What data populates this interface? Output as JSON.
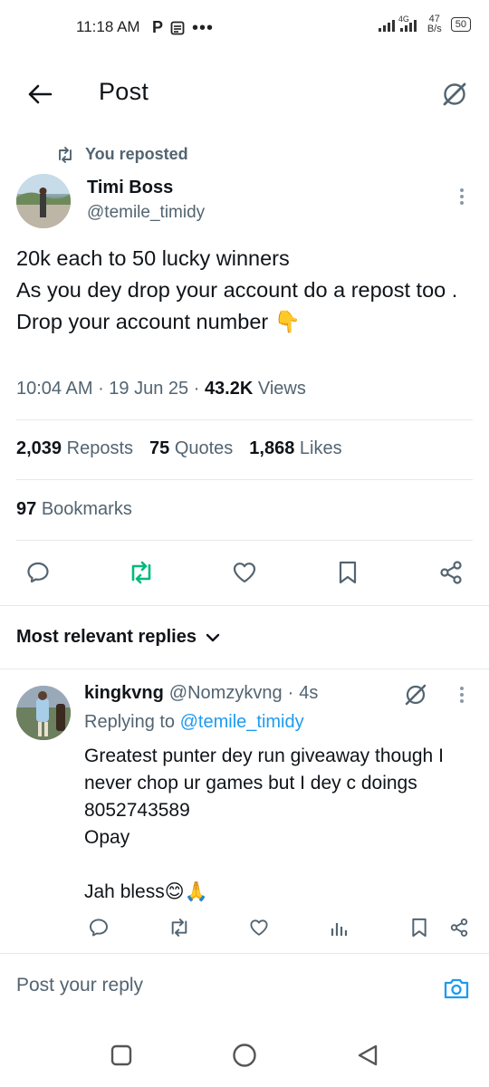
{
  "status_bar": {
    "time": "11:18 AM",
    "network": "4G",
    "speed_value": "47",
    "speed_unit": "B/s",
    "battery": "50"
  },
  "header": {
    "title": "Post"
  },
  "post": {
    "repost_label": "You reposted",
    "author_name": "Timi Boss",
    "author_handle": "@temile_timidy",
    "text": "20k each to 50 lucky winners\nAs you dey drop your account do a repost too . Drop your account number 👇",
    "time": "10:04 AM",
    "date": "19 Jun 25",
    "views_count": "43.2K",
    "views_label": "Views",
    "stats": {
      "reposts_count": "2,039",
      "reposts_label": "Reposts",
      "quotes_count": "75",
      "quotes_label": "Quotes",
      "likes_count": "1,868",
      "likes_label": "Likes",
      "bookmarks_count": "97",
      "bookmarks_label": "Bookmarks"
    }
  },
  "replies": {
    "heading": "Most relevant replies",
    "items": [
      {
        "name": "kingkvng",
        "handle": "@Nomzykvng",
        "time": "4s",
        "replying_prefix": "Replying to",
        "replying_handle": "@temile_timidy",
        "text": "Greatest punter dey run giveaway though I never chop ur games but I dey c doings\n8052743589\nOpay\n\nJah bless😊🙏"
      }
    ]
  },
  "composer": {
    "placeholder": "Post your reply"
  },
  "colors": {
    "text": "#0f1419",
    "muted": "#536471",
    "link": "#1d9bf0",
    "repost_active": "#00ba7c",
    "divider": "#e6e9ec"
  },
  "icons": [
    "back-arrow-icon",
    "grok-icon",
    "repost-icon",
    "more-icon",
    "reply-icon",
    "heart-icon",
    "bookmark-icon",
    "share-icon",
    "analytics-icon",
    "chevron-down-icon",
    "camera-icon",
    "square-nav-icon",
    "circle-nav-icon",
    "triangle-nav-icon"
  ]
}
